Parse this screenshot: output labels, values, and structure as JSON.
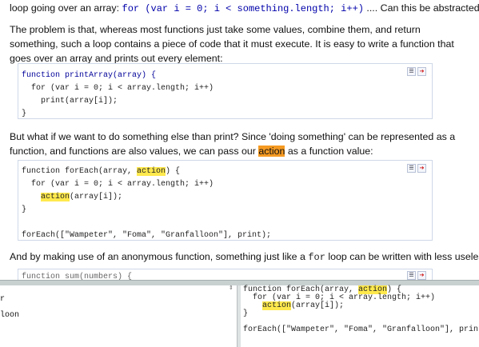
{
  "intro": {
    "prefix": "loop going over an array: ",
    "code": "for (var i = 0; i < something.length; i++)",
    "suffix": " .... Can this be abstracted?"
  },
  "para1": "The problem is that, whereas most functions just take some values, combine them, and return something, such a loop contains a piece of code that it must execute. It is easy to write a function that goes over an array and prints out every element:",
  "code1": {
    "lines": [
      "function printArray(array) {",
      "  for (var i = 0; i < array.length; i++)",
      "    print(array[i]);",
      "}"
    ]
  },
  "para2": {
    "before": "But what if we want to do something else than print? Since 'doing something' can be represented as a function, and functions are also values, we can pass our ",
    "highlight": "action",
    "after": " as a function value:"
  },
  "code2": {
    "line1_a": "function forEach(array, ",
    "line1_hl": "action",
    "line1_b": ") {",
    "line2": "  for (var i = 0; i < array.length; i++)",
    "line3_indent": "    ",
    "line3_hl": "action",
    "line3_b": "(array[i]);",
    "line4": "}",
    "line5": "",
    "line6": "forEach([\"Wampeter\", \"Foma\", \"Granfalloon\"], print);"
  },
  "para3": {
    "before": "And by making use of an anonymous function, something just like a ",
    "code": "for",
    "after": " loop can be written with less useless details:"
  },
  "code3": {
    "partial_line": "function sum(numbers) {"
  },
  "console_output": {
    "lines": [
      "r",
      "",
      "loon"
    ]
  },
  "editor": {
    "line1_a": "function forEach(array, ",
    "line1_hl": "action",
    "line1_b": ") {",
    "line2": "  for (var i = 0; i < array.length; i++)",
    "line3_indent": "    ",
    "line3_hl": "action",
    "line3_b": "(array[i]);",
    "line4": "}",
    "line5": "",
    "line6": "forEach([\"Wampeter\", \"Foma\", \"Granfalloon\"], print);"
  },
  "tools": {
    "load_icon": "load-into-console-icon",
    "run_icon": "run-code-icon"
  }
}
